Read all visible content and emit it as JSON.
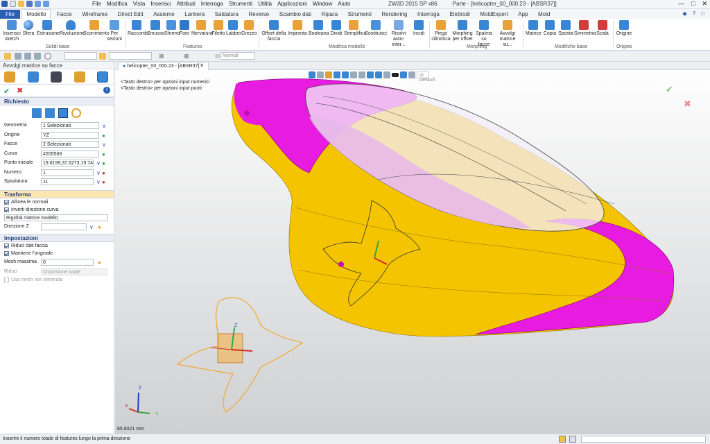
{
  "app": {
    "title": "ZW3D 2015 SP x86",
    "doc_title": "Parte - [helicopter_00_000.23 - [ABSR37]]",
    "menu": [
      "File",
      "Modifica",
      "Vista",
      "Inserisci",
      "Attributi",
      "Interroga",
      "Strumenti",
      "Utilità",
      "Applicazioni",
      "Window",
      "Aiuto"
    ]
  },
  "tabs": [
    "File",
    "Modello",
    "Facce",
    "Wireframe",
    "Direct Edit",
    "Assieme",
    "Lamiera",
    "Saldatura",
    "Reverse",
    "Scambio dati",
    "Ripara",
    "Strumenti",
    "Rendering",
    "Interroga",
    "Elettrodi",
    "MoldExpert",
    "App",
    "Mold"
  ],
  "active_tab": "Modello",
  "ribbon": {
    "groups": [
      {
        "title": "Solidi base",
        "buttons": [
          "Inserisci sketch",
          "Sfera",
          "Estrusione",
          "Rivoluzione",
          "Scorrimento",
          "Per sezioni"
        ]
      },
      {
        "title": "Features",
        "buttons": [
          "Raccordo",
          "Smusso",
          "Sformo",
          "Foro",
          "Nervatura",
          "Filetto",
          "Labbro",
          "Grezzo"
        ]
      },
      {
        "title": "Modifica modello",
        "buttons": [
          "Offset della faccia",
          "Impronta",
          "Booleana",
          "Dividi",
          "Semplifica",
          "Sostituisci",
          "Risolvi auto-inter...",
          "Incidi"
        ]
      },
      {
        "title": "Morphing",
        "buttons": [
          "Piega cilindrica",
          "Morphing per offset",
          "Spalma su facce",
          "Avvolgi matrice su..."
        ]
      },
      {
        "title": "Modifiche base",
        "buttons": [
          "Matrice",
          "Copia",
          "Sposta",
          "Simmetria",
          "Scala"
        ]
      },
      {
        "title": "Origine",
        "buttons": [
          "Origine"
        ]
      }
    ]
  },
  "quickbar": {
    "filter_value": "Normal"
  },
  "panel": {
    "title": "Avvolgi matrice su facce",
    "sections": {
      "required": "Richiesto",
      "transform": "Trasforma",
      "settings": "Impostazioni"
    },
    "fields": [
      {
        "label": "Geometria",
        "value": "1 Selezionati"
      },
      {
        "label": "Origine",
        "value": "YZ"
      },
      {
        "label": "Facce",
        "value": "2 Selezionati"
      },
      {
        "label": "Curva",
        "value": "#205569"
      },
      {
        "label": "Punto iniziale",
        "value": "19.8199,37.6273,19.74"
      },
      {
        "label": "Numero",
        "value": "1"
      },
      {
        "label": "Spaziatura",
        "value": "11"
      }
    ],
    "transform": {
      "align_normals": "Allinea le normali",
      "invert_curve": "Inverti direzione curva",
      "rigidity": "Rigidità matrice modello",
      "dir_z_label": "Direzione Z"
    },
    "settings": {
      "reduce": "Riduci dati faccia",
      "keep": "Mantiene l'originale",
      "mesh_label": "Mesh massima",
      "mesh_value": "0",
      "reduce_label": "Riduci",
      "reduce_value": "Distorsione totale",
      "raw_mesh": "Usa mesh non trimmata"
    }
  },
  "viewport": {
    "doc_tab": "helicopter_00_000.23 - [ABSR37]",
    "hint1": "<Tasto destro> per opzioni input numerici",
    "hint2": "<Tasto destro> per opzioni input punti",
    "view_default": "Default",
    "measure": "65.8021 mm",
    "axis_labels": [
      "Z",
      "Y",
      "X"
    ]
  },
  "status": {
    "message": "Inserire il numero totale di features lungo la prima direzione"
  },
  "colors": {
    "accent": "#2b5fb3",
    "body": "#f5c400",
    "magenta": "#e81ce0",
    "orange": "#f0a830"
  }
}
